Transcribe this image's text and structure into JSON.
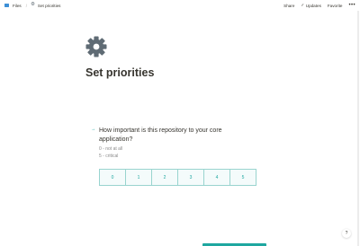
{
  "breadcrumb": {
    "items": [
      {
        "label": "Files",
        "icon": "folder-icon"
      },
      {
        "label": "Set priorities",
        "icon": "gear-icon"
      }
    ],
    "separator": "/"
  },
  "topbar": {
    "share_label": "Share",
    "updates_label": "Updates",
    "favorite_label": "Favorite",
    "more_label": "•••"
  },
  "page": {
    "icon": "gear-icon",
    "title": "Set priorities"
  },
  "question": {
    "arrow": "→",
    "text": "How important is this repository to your core application?",
    "scale_low": "0 - not at all",
    "scale_high": "5 - critical",
    "options": [
      "0",
      "1",
      "2",
      "3",
      "4",
      "5"
    ]
  },
  "help": {
    "label": "?"
  },
  "colors": {
    "accent": "#1ea7a0",
    "text": "#37352f",
    "muted": "#8a8a8a",
    "icon_gray": "#5f6b74",
    "files_blue": "#3d8fd6"
  }
}
